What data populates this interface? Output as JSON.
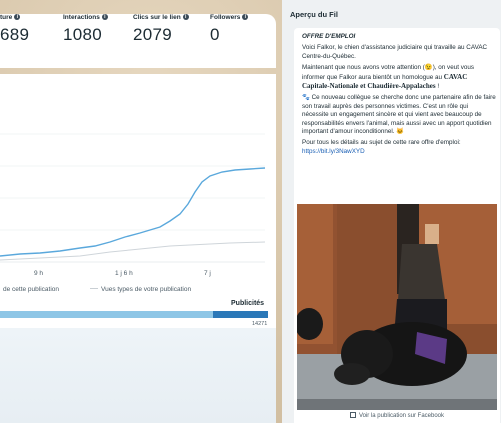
{
  "stats": [
    {
      "label": "ture",
      "value": "689"
    },
    {
      "label": "Interactions",
      "value": "1080"
    },
    {
      "label": "Clics sur le lien",
      "value": "2079"
    },
    {
      "label": "Followers",
      "value": "0"
    }
  ],
  "chart": {
    "x_ticks": [
      "9 h",
      "1 j 6 h",
      "7 j"
    ],
    "legend": [
      "de cette publication",
      "Vues types de votre publication"
    ],
    "colors": {
      "main": "#5aa8dc",
      "typical": "#c9cfd4"
    }
  },
  "publicites": {
    "label": "Publicités",
    "value": "14271"
  },
  "preview": {
    "title": "Aperçu du Fil",
    "headline": "OFFRE D'EMPLOI",
    "para1": "Voici Falkor, le chien d'assistance judiciaire qui travaille au CAVAC Centre-du-Québec.",
    "para2_start": "Maintenant que nous avons votre attention (😉), on veut vous informer que Falkor aura bientôt un homologue au ",
    "para2_bold": "CAVAC Capitale-Nationale et Chaudière-Appalaches",
    "para2_end": " !",
    "para3": "🐾 Ce nouveau collègue se cherche donc une partenaire afin de faire son travail auprès des personnes victimes. C'est un rôle qui nécessite un engagement sincère et qui vient avec beaucoup de responsabilités envers l'animal, mais aussi avec un apport quotidien important d'amour inconditionnel. 🐱",
    "para4_start": "Pour tous les détails au sujet de cette rare offre d'emploi: ",
    "link": "https://bit.ly/3NawXYD",
    "fb_link": "Voir la publication sur Facebook"
  }
}
